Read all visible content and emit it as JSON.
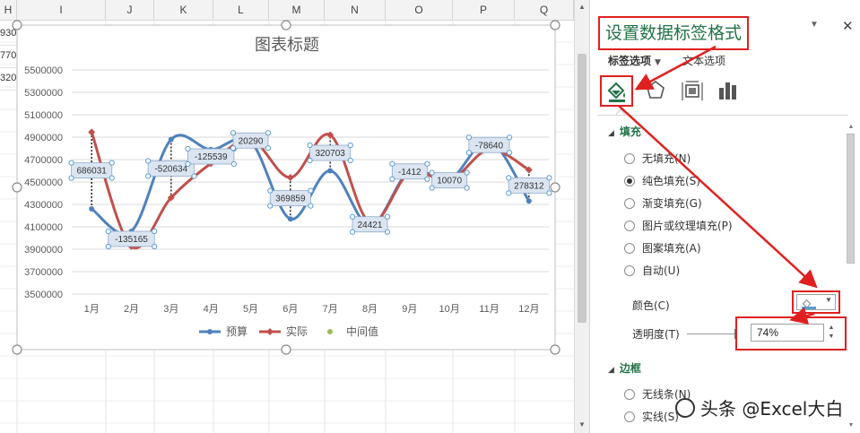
{
  "sheet": {
    "columns": [
      "H",
      "I",
      "J",
      "K",
      "L",
      "M",
      "N",
      "O",
      "P",
      "Q"
    ],
    "cell_fragments": [
      "930",
      "770",
      "320"
    ]
  },
  "chart_data": {
    "type": "line",
    "title": "图表标题",
    "categories": [
      "1月",
      "2月",
      "3月",
      "4月",
      "5月",
      "6月",
      "7月",
      "8月",
      "9月",
      "10月",
      "11月",
      "12月"
    ],
    "series": [
      {
        "name": "预算",
        "color": "#4f81bd",
        "values": [
          4260000,
          4060000,
          4880000,
          4790000,
          4860000,
          4170000,
          4600000,
          4110000,
          4600000,
          4520000,
          4870000,
          4330000
        ]
      },
      {
        "name": "实际",
        "color": "#c0504d",
        "values": [
          4945000,
          3925000,
          4360000,
          4665000,
          4880000,
          4540000,
          4920000,
          4135000,
          4587000,
          4510000,
          4791000,
          4608000
        ]
      },
      {
        "name": "中间值",
        "color": "#9bbb59",
        "values": [
          4603000,
          3992000,
          4620000,
          4728000,
          4870000,
          4355000,
          4760000,
          4122000,
          4594000,
          4515000,
          4830000,
          4469000
        ]
      }
    ],
    "data_labels": [
      "686031",
      "-135165",
      "-520634",
      "-125539",
      "20290",
      "369859",
      "320703",
      "24421",
      "-1412",
      "10070",
      "-78640",
      "278312"
    ],
    "ylim": [
      3500000,
      5500000
    ],
    "yticks": [
      3500000,
      3700000,
      3900000,
      4100000,
      4300000,
      4500000,
      4700000,
      4900000,
      5100000,
      5300000,
      5500000
    ],
    "ytick_labels": [
      "3500000",
      "3700000",
      "3900000",
      "4100000",
      "4300000",
      "4500000",
      "4700000",
      "4900000",
      "5100000",
      "5300000",
      "5500000"
    ],
    "grid": true,
    "legend_position": "bottom",
    "xlabel": "",
    "ylabel": ""
  },
  "pane": {
    "title": "设置数据标签格式",
    "tabs": {
      "label_options": "标签选项",
      "text_options": "文本选项"
    },
    "icons": [
      "fill-line-icon",
      "effects-icon",
      "size-properties-icon",
      "label-options-icon"
    ],
    "fill_section": {
      "title": "填充",
      "options": [
        "无填充(N)",
        "纯色填充(S)",
        "渐变填充(G)",
        "图片或纹理填充(P)",
        "图案填充(A)",
        "自动(U)"
      ],
      "selected_index": 1
    },
    "color_label": "颜色(C)",
    "color_value": "#5b9bd5",
    "transparency_label": "透明度(T)",
    "transparency_value": "74%",
    "transparency_level": 0.74,
    "border_section": {
      "title": "边框",
      "options": [
        "无线条(N)",
        "实线(S)"
      ]
    },
    "close_glyph": "✕"
  },
  "watermark": "头条 @Excel大白",
  "annotation_color": "#e02020"
}
